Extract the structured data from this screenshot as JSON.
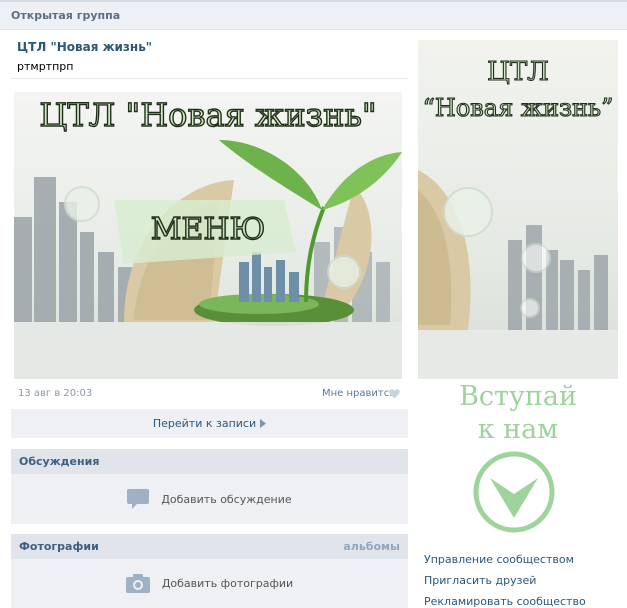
{
  "topbar": {
    "title": "Открытая группа"
  },
  "post": {
    "title": "ЦТЛ \"Новая жизнь\"",
    "subtitle": "ртмртпрп",
    "banner": {
      "title": "ЦТЛ \"Новая жизнь\"",
      "menu_label": "МЕНЮ"
    },
    "date": "13 авг в 20:03",
    "like_label": "Мне нравится",
    "goto_label": "Перейти к записи"
  },
  "discussions": {
    "header": "Обсуждения",
    "add_label": "Добавить обсуждение"
  },
  "photos": {
    "header": "Фотографии",
    "albums_link": "альбомы",
    "add_label": "Добавить фотографии"
  },
  "side_banner": {
    "line1": "ЦТЛ",
    "line2": "“Новая жизнь”"
  },
  "cta": {
    "line1": "Вступай",
    "line2": "к нам"
  },
  "side_links": [
    "Управление сообществом",
    "Пригласить друзей",
    "Рекламировать сообщество"
  ],
  "colors": {
    "link": "#2b587a",
    "accent_green": "#9fd39c",
    "header_bg": "#e1e5eb"
  },
  "icons": [
    "heart-icon",
    "chevron-right-icon",
    "chat-bubble-icon",
    "camera-icon",
    "down-arrow-circle-icon"
  ]
}
